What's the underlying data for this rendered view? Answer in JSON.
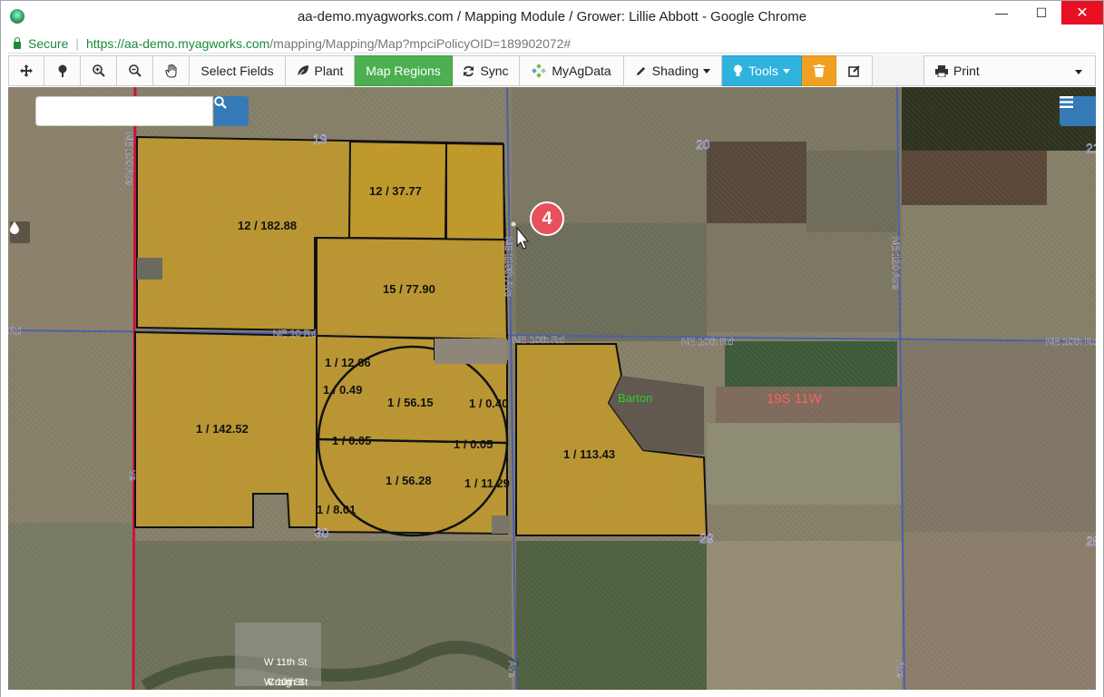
{
  "window": {
    "title": "aa-demo.myagworks.com / Mapping Module / Grower: Lillie Abbott - Google Chrome",
    "min_label": "—",
    "max_label": "☐",
    "close_label": "✕"
  },
  "address": {
    "secure_label": "Secure",
    "separator": "|",
    "url_host": "https://aa-demo.myagworks.com",
    "url_path": "/mapping/Mapping/Map?mpciPolicyOID=189902072#"
  },
  "toolbar": {
    "select_fields": "Select Fields",
    "plant": "Plant",
    "map_regions": "Map Regions",
    "sync": "Sync",
    "myagdata": "MyAgData",
    "shading": "Shading",
    "tools": "Tools",
    "print": "Print"
  },
  "colors": {
    "map_regions_active": "#4caf50",
    "tools": "#2fb3de",
    "delete": "#f0a020",
    "field_fill": "#c09a2c",
    "road": "#4b5fae",
    "highway": "#d0103a",
    "badge": "#e8505b"
  },
  "search": {
    "placeholder": ""
  },
  "step_badge": "4",
  "map": {
    "section_numbers": [
      "19",
      "20",
      "21",
      "30",
      "29",
      "28"
    ],
    "road_labels": [
      "NE 100 Ave",
      "NE 110th Ave",
      "NE 120 Ave",
      "NE 10 Rd",
      "NE 10th Rd",
      "NE 10th Rd",
      "NE 10th Rd",
      "Rd"
    ],
    "town_streets": [
      "W 11th St",
      "W 10th St",
      "Craig St"
    ],
    "place_label": "Barton",
    "township_label": "19S 11W",
    "fields": [
      "12 / 182.88",
      "12 / 37.77",
      "15 / 77.90",
      "1 / 142.52",
      "1 / 12.66",
      "1 / 0.49",
      "1 / 56.15",
      "1 / 0.40",
      "1 / 0.05",
      "1 / 0.05",
      "1 / 56.28",
      "1 / 11.29",
      "1 / 8.01",
      "1 / 113.43"
    ],
    "partial_labels": [
      "ve",
      "Ave",
      "Ave"
    ]
  }
}
